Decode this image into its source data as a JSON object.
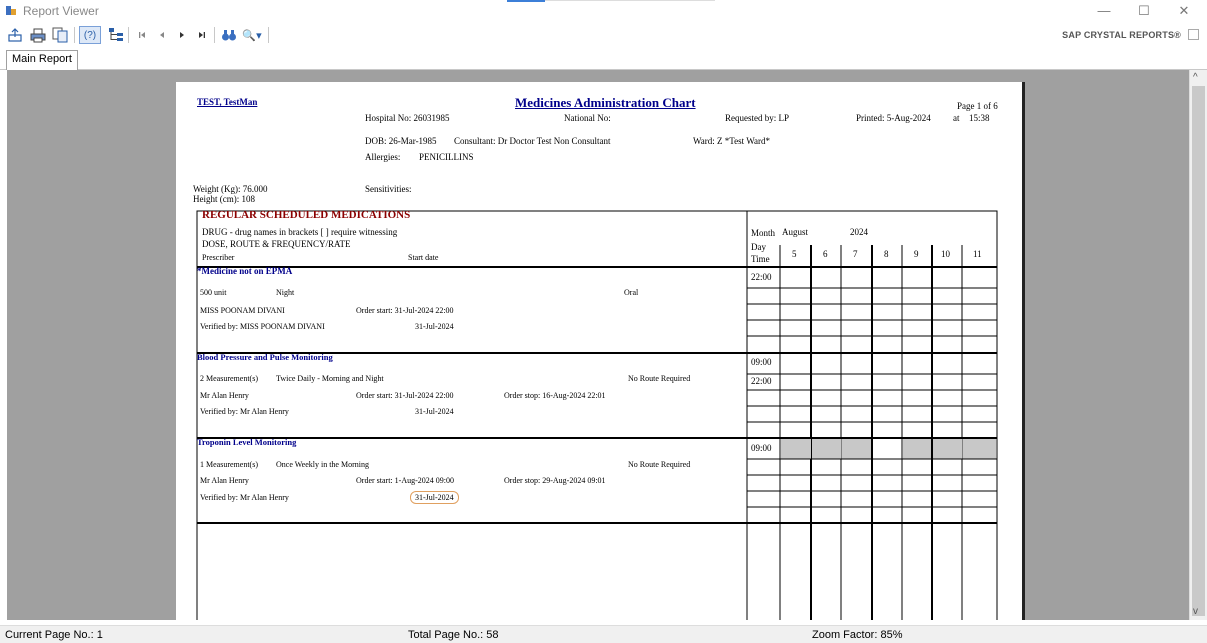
{
  "window": {
    "title": "Report Viewer",
    "minimize": "—",
    "maximize": "☐",
    "close": "✕"
  },
  "toolbar": {
    "brand": "SAP CRYSTAL REPORTS®",
    "help": "(?)",
    "search_glyph": "🔍▾"
  },
  "tabs": [
    {
      "label": "Main Report"
    }
  ],
  "report": {
    "patient": "TEST, TestMan",
    "title": "Medicines Administration Chart",
    "page": "Page 1 of 6",
    "hospital_no": "Hospital No: 26031985",
    "national_no": "National No:",
    "requested_by": "Requested by: LP",
    "printed": "Printed: 5-Aug-2024",
    "printed_at": "at",
    "printed_time": "15:38",
    "dob": "DOB: 26-Mar-1985",
    "consultant": "Consultant: Dr Doctor Test Non Consultant",
    "ward": "Ward: Z *Test Ward*",
    "allergies_label": "Allergies:",
    "allergies": "PENICILLINS",
    "weight": "Weight (Kg):  76.000",
    "height": "Height (cm):  108",
    "sensitivities": "Sensitivities:",
    "section_title": "REGULAR SCHEDULED MEDICATIONS",
    "drug_header": "DRUG  - drug names in brackets [ ] require witnessing",
    "dose_header": "DOSE, ROUTE & FREQUENCY/RATE",
    "prescriber_header": "Prescriber",
    "start_date_header": "Start date",
    "month_label": "Month",
    "month": "August",
    "year": "2024",
    "day_label": "Day",
    "time_label": "Time",
    "days": [
      "5",
      "6",
      "7",
      "8",
      "9",
      "10",
      "11"
    ],
    "medications": [
      {
        "name": "*Medicine not on EPMA",
        "dose": "500 unit",
        "frequency": "Night",
        "route": "Oral",
        "prescriber": "MISS POONAM DIVANI",
        "order_start": "Order start:  31-Jul-2024 22:00",
        "order_stop": "",
        "verified_by": "Verified by:   MISS POONAM DIVANI",
        "verified_date": "31-Jul-2024",
        "times": [
          "22:00"
        ]
      },
      {
        "name": "Blood Pressure and Pulse Monitoring",
        "dose": "2 Measurement(s)",
        "frequency": "Twice Daily - Morning and Night",
        "route": "No Route Required",
        "prescriber": "Mr Alan Henry",
        "order_start": "Order start:  31-Jul-2024 22:00",
        "order_stop": "Order stop: 16-Aug-2024 22:01",
        "verified_by": "Verified by:   Mr Alan Henry",
        "verified_date": "31-Jul-2024",
        "times": [
          "09:00",
          "22:00"
        ]
      },
      {
        "name": "Troponin Level Monitoring",
        "dose": "1 Measurement(s)",
        "frequency": "Once Weekly in the Morning",
        "route": "No Route Required",
        "prescriber": "Mr Alan Henry",
        "order_start": "Order start:  1-Aug-2024 09:00",
        "order_stop": "Order stop: 29-Aug-2024 09:01",
        "verified_by": "Verified by:   Mr Alan Henry",
        "verified_date": "31-Jul-2024",
        "times": [
          "09:00"
        ]
      }
    ]
  },
  "status": {
    "current_page": "Current Page No.: 1",
    "total_pages": "Total Page No.: 58",
    "zoom": "Zoom Factor: 85%"
  },
  "colors": {
    "section_red": "#8b0000",
    "drug_blue": "#00008b",
    "viewer_bg": "#a0a0a0",
    "shaded_cell": "#c8c8c8"
  }
}
